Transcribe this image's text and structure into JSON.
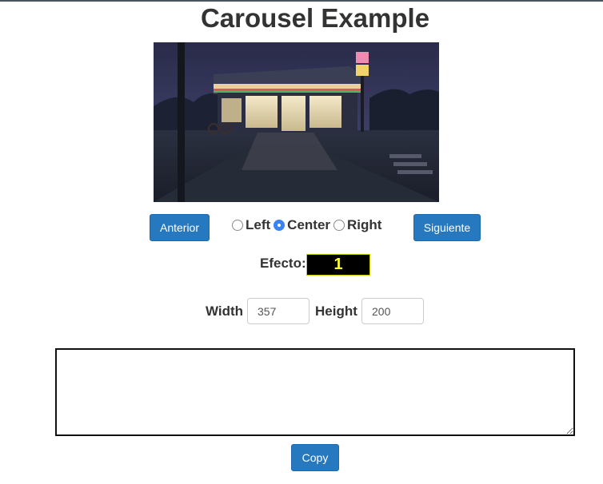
{
  "page": {
    "title": "Carousel Example"
  },
  "carousel": {
    "image_alt": "Convenience store at dusk",
    "prev_label": "Anterior",
    "next_label": "Siguiente",
    "alignment_options": [
      {
        "label": "Left",
        "checked": false
      },
      {
        "label": "Center",
        "checked": true
      },
      {
        "label": "Right",
        "checked": false
      }
    ],
    "efecto_label": "Efecto:",
    "efecto_value": "1",
    "width_label": "Width",
    "width_value": "357",
    "height_label": "Height",
    "height_value": "200"
  },
  "output": {
    "textarea_value": "",
    "copy_label": "Copy"
  },
  "colors": {
    "button_bg": "#2779bf",
    "radio_checked": "#3b82f6",
    "efecto_bg": "#000000",
    "efecto_text": "#ffff33"
  }
}
